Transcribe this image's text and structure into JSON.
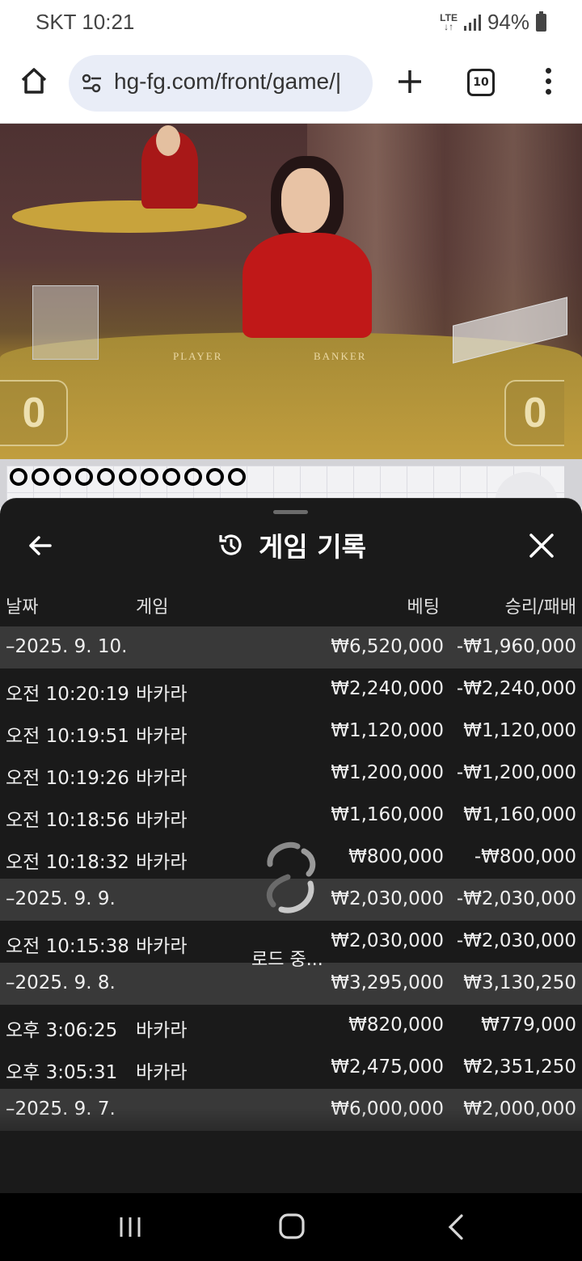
{
  "status_bar": {
    "carrier_time": "SKT 10:21",
    "network": "LTE",
    "battery": "94%"
  },
  "browser": {
    "url": "hg-fg.com/front/game/|",
    "tab_count": "10"
  },
  "video": {
    "player_label": "PLAYER",
    "banker_label": "BANKER",
    "player_score": "0",
    "banker_score": "0"
  },
  "roadmap": {
    "beads": [
      "blue",
      "red",
      "blue",
      "red",
      "blue",
      "red",
      "blue",
      "red",
      "blue",
      "red",
      "blue"
    ]
  },
  "sheet": {
    "title": "게임 기록",
    "columns": {
      "date": "날짜",
      "game": "게임",
      "bet": "베팅",
      "result": "승리/패배"
    },
    "rows": [
      {
        "type": "date",
        "date": "–2025. 9. 10.",
        "game": "",
        "bet": "₩6,520,000",
        "result": "-₩1,960,000"
      },
      {
        "type": "item",
        "date": "오전 10:20:19",
        "game": "바카라",
        "bet": "₩2,240,000",
        "result": "-₩2,240,000"
      },
      {
        "type": "item",
        "date": "오전 10:19:51",
        "game": "바카라",
        "bet": "₩1,120,000",
        "result": "₩1,120,000"
      },
      {
        "type": "item",
        "date": "오전 10:19:26",
        "game": "바카라",
        "bet": "₩1,200,000",
        "result": "-₩1,200,000"
      },
      {
        "type": "item",
        "date": "오전 10:18:56",
        "game": "바카라",
        "bet": "₩1,160,000",
        "result": "₩1,160,000"
      },
      {
        "type": "item",
        "date": "오전 10:18:32",
        "game": "바카라",
        "bet": "₩800,000",
        "result": "-₩800,000"
      },
      {
        "type": "date",
        "date": "–2025. 9. 9.",
        "game": "",
        "bet": "₩2,030,000",
        "result": "-₩2,030,000"
      },
      {
        "type": "item",
        "date": "오전 10:15:38",
        "game": "바카라",
        "bet": "₩2,030,000",
        "result": "-₩2,030,000"
      },
      {
        "type": "date",
        "date": "–2025. 9. 8.",
        "game": "",
        "bet": "₩3,295,000",
        "result": "₩3,130,250"
      },
      {
        "type": "item",
        "date": "오후 3:06:25",
        "game": "바카라",
        "bet": "₩820,000",
        "result": "₩779,000"
      },
      {
        "type": "item",
        "date": "오후 3:05:31",
        "game": "바카라",
        "bet": "₩2,475,000",
        "result": "₩2,351,250"
      },
      {
        "type": "date",
        "date": "–2025. 9. 7.",
        "game": "",
        "bet": "₩6,000,000",
        "result": "₩2,000,000"
      }
    ],
    "loading_text": "로드 중..."
  }
}
